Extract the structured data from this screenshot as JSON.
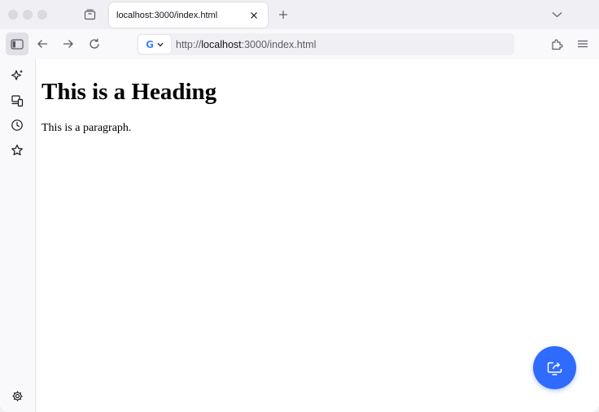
{
  "tabs": [
    {
      "title": "localhost:3000/index.html",
      "active": true
    }
  ],
  "address_bar": {
    "scheme": "http://",
    "host": "localhost",
    "rest": ":3000/index.html",
    "search_engine_icon": "google-icon"
  },
  "page": {
    "heading": "This is a Heading",
    "paragraph": "This is a paragraph."
  },
  "icons": {
    "tab_overview": "tab-overview-icon",
    "tab_close": "close-icon",
    "new_tab": "plus-icon",
    "tab_list": "chevron-down-icon",
    "sidebar_toggle": "sidebar-icon",
    "back": "arrow-left-icon",
    "forward": "arrow-right-icon",
    "reload": "reload-icon",
    "extensions": "puzzle-icon",
    "menu": "hamburger-icon",
    "sidebar_items": [
      "sparkle-icon",
      "synced-tabs-icon",
      "history-icon",
      "star-icon"
    ],
    "settings": "gear-icon",
    "floating_action": "share-screen-icon"
  },
  "colors": {
    "fab": "#2f6bff",
    "chrome": "#f0f0f4",
    "toolbar": "#f9f9fb"
  }
}
